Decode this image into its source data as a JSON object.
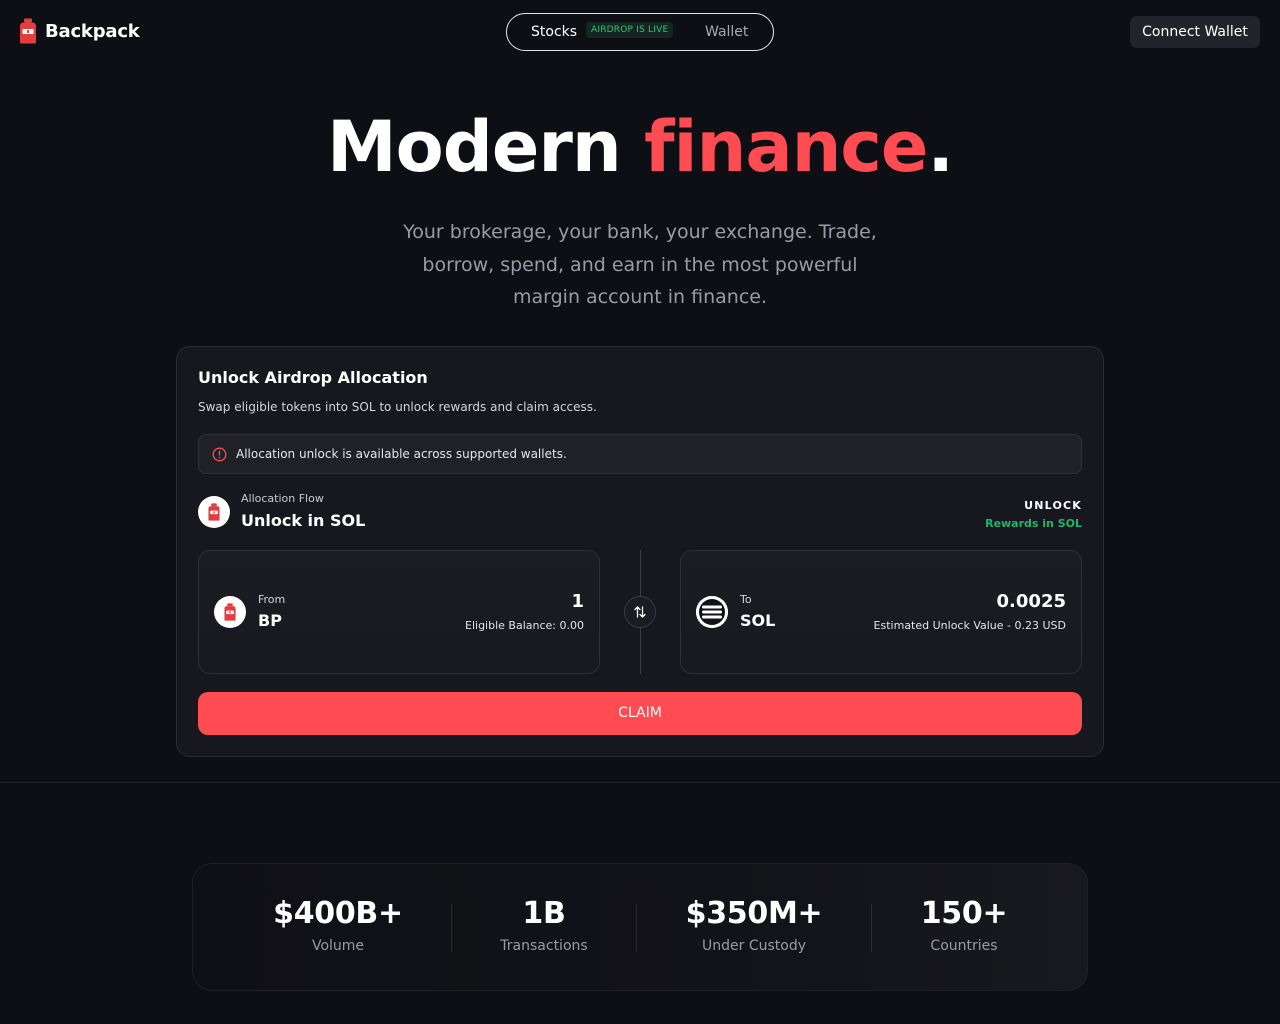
{
  "header": {
    "brand": "Backpack",
    "nav": {
      "stocks_label": "Stocks",
      "badge": "AIRDROP IS LIVE",
      "wallet_label": "Wallet"
    },
    "connect_label": "Connect Wallet"
  },
  "hero": {
    "title_main": "Modern",
    "title_accent": "finance",
    "title_dot": ".",
    "subtitle_line1": "Your brokerage, your bank, your exchange. Trade,",
    "subtitle_line2": "borrow, spend, and earn in the most powerful",
    "subtitle_line3": "margin account in finance."
  },
  "card": {
    "title": "Unlock Airdrop Allocation",
    "subtitle": "Swap eligible tokens into SOL to unlock rewards and claim access.",
    "notice": "Allocation unlock is available across supported wallets.",
    "flow_label": "Allocation Flow",
    "flow_name": "Unlock in SOL",
    "unlock_label": "UNLOCK",
    "unlock_sub": "Rewards in SOL",
    "from": {
      "direction": "From",
      "symbol": "BP",
      "amount": "1",
      "meta": "Eligible Balance: 0.00"
    },
    "to": {
      "direction": "To",
      "symbol": "SOL",
      "amount": "0.0025",
      "meta": "Estimated Unlock Value - 0.23 USD"
    },
    "claim_label": "CLAIM"
  },
  "stats": [
    {
      "value": "$400B+",
      "label": "Volume"
    },
    {
      "value": "1B",
      "label": "Transactions"
    },
    {
      "value": "$350M+",
      "label": "Under Custody"
    },
    {
      "value": "150+",
      "label": "Countries"
    }
  ],
  "colors": {
    "background": "#0e0f14",
    "accent": "#ff4b52",
    "success": "#1fb76e",
    "card": "#17181d"
  },
  "icons": {
    "logo": "backpack-icon",
    "notice": "alert-circle-icon",
    "swap": "swap-arrows-icon",
    "sol": "solana-icon"
  }
}
